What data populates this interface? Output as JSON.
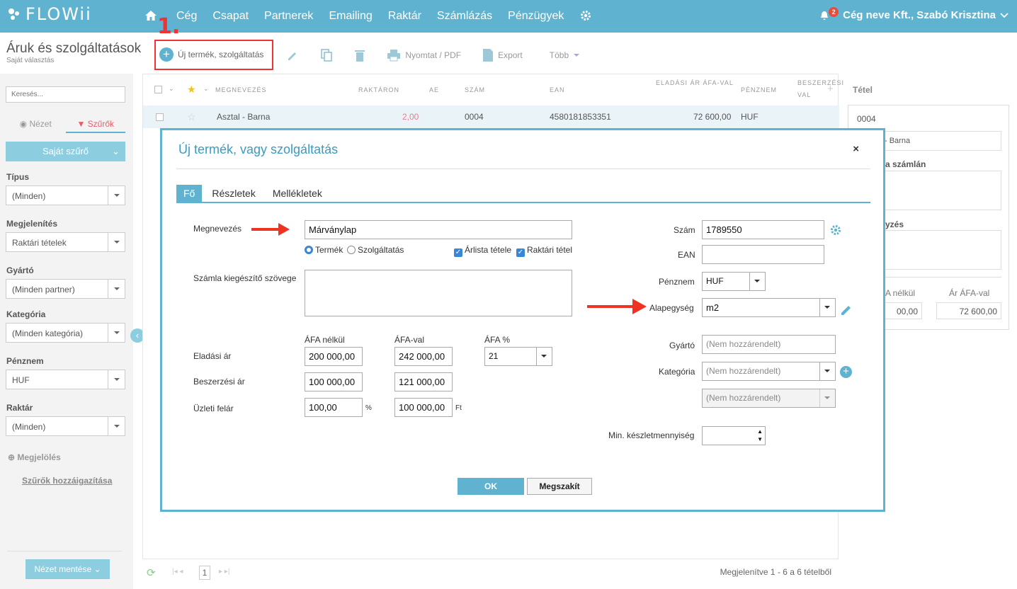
{
  "topbar": {
    "logo": "FLOWii",
    "nav": [
      "Cég",
      "Csapat",
      "Partnerek",
      "Emailing",
      "Raktár",
      "Számlázás",
      "Pénzügyek"
    ],
    "notifications": "2",
    "user": "Cég neve Kft., Szabó Krisztina"
  },
  "annotation": "1.",
  "page": {
    "title": "Áruk és szolgáltatások",
    "subtitle": "Saját választás"
  },
  "toolbar": {
    "new": "Új termék, szolgáltatás",
    "print": "Nyomtat / PDF",
    "export": "Export",
    "more": "Több"
  },
  "sidebar": {
    "search_placeholder": "Keresés...",
    "tab_view": "Nézet",
    "tab_filters": "Szűrők",
    "own_filter": "Saját szűrő",
    "filters": [
      {
        "label": "Típus",
        "value": "(Minden)"
      },
      {
        "label": "Megjelenítés",
        "value": "Raktári tételek"
      },
      {
        "label": "Gyártó",
        "value": "(Minden partner)"
      },
      {
        "label": "Kategória",
        "value": "(Minden kategória)"
      },
      {
        "label": "Pénznem",
        "value": "HUF"
      },
      {
        "label": "Raktár",
        "value": "(Minden)"
      }
    ],
    "marking": "Megjelölés",
    "adjust": "Szűrők hozzáigazítása",
    "save_view": "Nézet mentése"
  },
  "grid": {
    "headers": {
      "name": "MEGNEVEZÉS",
      "stock": "RAKTÁRON",
      "unit": "AE",
      "number": "SZÁM",
      "ean": "EAN",
      "price1": "ELADÁSI ÁR ÁFA-VAL",
      "currency": "PÉNZNEM",
      "buy1": "BESZERZÉSI",
      "buy2": "VAL"
    },
    "row": {
      "name": "Asztal - Barna",
      "stock": "2,00",
      "number": "0004",
      "ean": "4580181853351",
      "price": "72 600,00",
      "currency": "HUF"
    },
    "page": "1",
    "footer": "Megjelenítve 1 - 6 a 6 tételből"
  },
  "right_panel": {
    "title": "Tétel",
    "number": "0004",
    "name_partial": "- Barna",
    "on_invoice_partial": "a számlán",
    "desc_partial": "yzés",
    "net_label_partial": "A nélkül",
    "gross_label": "Ár ÁFA-val",
    "net_partial": "00,00",
    "gross": "72 600,00"
  },
  "modal": {
    "title": "Új termék, vagy szolgáltatás",
    "close": "×",
    "tabs": [
      "Fő",
      "Részletek",
      "Mellékletek"
    ],
    "name_label": "Megnevezés",
    "name_value": "Márványlap",
    "radio_product": "Termék",
    "radio_service": "Szolgáltatás",
    "check_pricelist": "Árlista tétele",
    "check_stock": "Raktári tétel",
    "invoice_text_label": "Számla kiegészítő szövege",
    "col_net": "ÁFA nélkül",
    "col_gross": "ÁFA-val",
    "col_vat": "ÁFA %",
    "sell_label": "Eladási ár",
    "sell_net": "200 000,00",
    "sell_gross": "242 000,00",
    "vat": "21",
    "buy_label": "Beszerzési ár",
    "buy_net": "100 000,00",
    "buy_gross": "121 000,00",
    "markup_label": "Üzleti felár",
    "markup_pct": "100,00",
    "pct_sign": "%",
    "markup_amount": "100 000,00",
    "ft": "Ft",
    "number_label": "Szám",
    "number_value": "1789550",
    "ean_label": "EAN",
    "currency_label": "Pénznem",
    "currency_value": "HUF",
    "unit_label": "Alapegység",
    "unit_value": "m2",
    "maker_label": "Gyártó",
    "maker_placeholder": "(Nem hozzárendelt)",
    "category_label": "Kategória",
    "category_value": "(Nem hozzárendelt)",
    "subcategory_value": "(Nem hozzárendelt)",
    "min_stock_label": "Min. készletmennyiség",
    "ok": "OK",
    "cancel": "Megszakít"
  },
  "colors": {
    "brand": "#5fb3d0",
    "annotation": "#ee3322"
  }
}
